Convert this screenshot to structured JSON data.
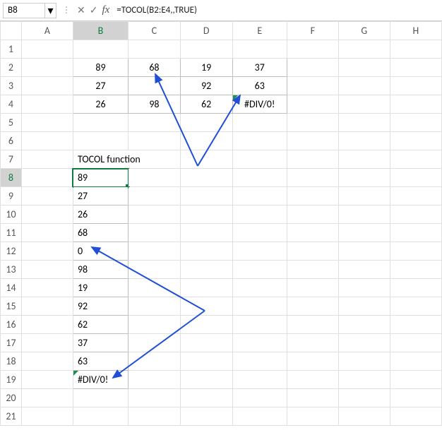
{
  "namebox": {
    "value": "B8"
  },
  "formula_bar": {
    "formula": "=TOCOL(B2:E4,,TRUE)"
  },
  "columns": [
    "A",
    "B",
    "C",
    "D",
    "E",
    "F",
    "G",
    "H"
  ],
  "rows": [
    "1",
    "2",
    "3",
    "4",
    "5",
    "6",
    "7",
    "8",
    "9",
    "10",
    "11",
    "12",
    "13",
    "14",
    "15",
    "16",
    "17",
    "18",
    "19",
    "20",
    "21"
  ],
  "source_table": {
    "r2": {
      "B": "89",
      "C": "68",
      "D": "19",
      "E": "37"
    },
    "r3": {
      "B": "27",
      "C": "",
      "D": "92",
      "E": "63"
    },
    "r4": {
      "B": "26",
      "C": "98",
      "D": "62",
      "E": "#DIV/0!"
    }
  },
  "label": {
    "B7": "TOCOL function"
  },
  "result_col": {
    "B8": "89",
    "B9": "27",
    "B10": "26",
    "B11": "68",
    "B12": "0",
    "B13": "98",
    "B14": "19",
    "B15": "92",
    "B16": "62",
    "B17": "37",
    "B18": "63",
    "B19": "#DIV/0!"
  },
  "icons": {
    "dropdown": "▾",
    "cancel": "✕",
    "confirm": "✓"
  },
  "fx_label": "fx"
}
